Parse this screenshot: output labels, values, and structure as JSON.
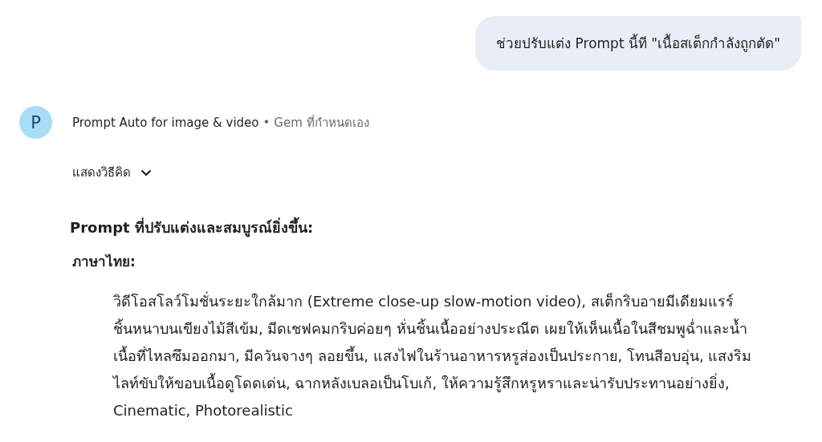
{
  "user_message": {
    "text": "ช่วยปรับแต่ง Prompt นี้ที \"เนื้อสเต็กกำลังถูกตัด\""
  },
  "response": {
    "avatar": {
      "letter": "P"
    },
    "sender": "Prompt Auto for image & video",
    "separator": "•",
    "sender_type": "Gem ที่กำหนดเอง",
    "thinking_toggle": {
      "label": "แสดงวิธีคิด",
      "expanded": false
    },
    "heading": "Prompt ที่ปรับแต่งและสมบูรณ์ยิ่งขึ้น:",
    "subheading": "ภาษาไทย:",
    "quote": "วิดีโอสโลว์โมชั่นระยะใกล้มาก (Extreme close-up slow-motion video), สเต็กริบอายมีเดียมแรร์ ชิ้นหนาบนเขียงไม้สีเข้ม, มีดเชฟคมกริบค่อยๆ หั่นชิ้นเนื้ออย่างประณีต เผยให้เห็นเนื้อในสีชมพูฉ่ำและน้ำเนื้อที่ไหลซึมออกมา, มีควันจางๆ ลอยขึ้น, แสงไฟในร้านอาหารหรูส่องเป็นประกาย, โทนสีอบอุ่น, แสงริมไลท์ขับให้ขอบเนื้อดูโดดเด่น, ฉากหลังเบลอเป็นโบเก้, ให้ความรู้สึกหรูหราและน่ารับประทานอย่างยิ่ง, Cinematic, Photorealistic"
  }
}
